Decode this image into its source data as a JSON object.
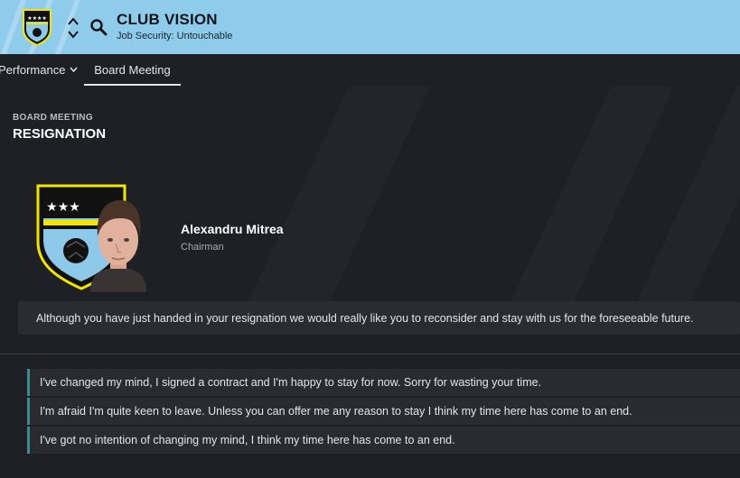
{
  "header": {
    "title": "CLUB VISION",
    "subtitle": "Job Security: Untouchable",
    "colors": {
      "background": "#8fcbeb",
      "title": "#111418"
    }
  },
  "tabs": [
    {
      "label": "Performance",
      "has_dropdown": true,
      "active": false
    },
    {
      "label": "Board Meeting",
      "active": true
    }
  ],
  "section": {
    "label": "BOARD MEETING",
    "title": "RESIGNATION"
  },
  "speaker": {
    "name": "Alexandru Mitrea",
    "role": "Chairman"
  },
  "message": "Although you have just handed in your resignation we would really like you to reconsider and stay with us for the foreseeable future.",
  "options": [
    {
      "label": "I've changed my mind, I signed a contract and I'm happy to stay for now. Sorry for wasting your time."
    },
    {
      "label": "I'm afraid I'm quite keen to leave. Unless you can offer me any reason to stay I think my time here has come to an end."
    },
    {
      "label": "I've got no intention of changing my mind, I think my time here has come to an end."
    }
  ],
  "icons": [
    "club-badge-icon",
    "nav-arrows-icon",
    "search-icon",
    "chevron-down-icon",
    "club-crest-icon",
    "chairman-portrait"
  ],
  "theme": {
    "accent": "#3c8d8a",
    "background": "#1f2025",
    "panel": "#2a2b31",
    "badge_yellow": "#f2e600",
    "badge_blue": "#8ec9ea"
  }
}
